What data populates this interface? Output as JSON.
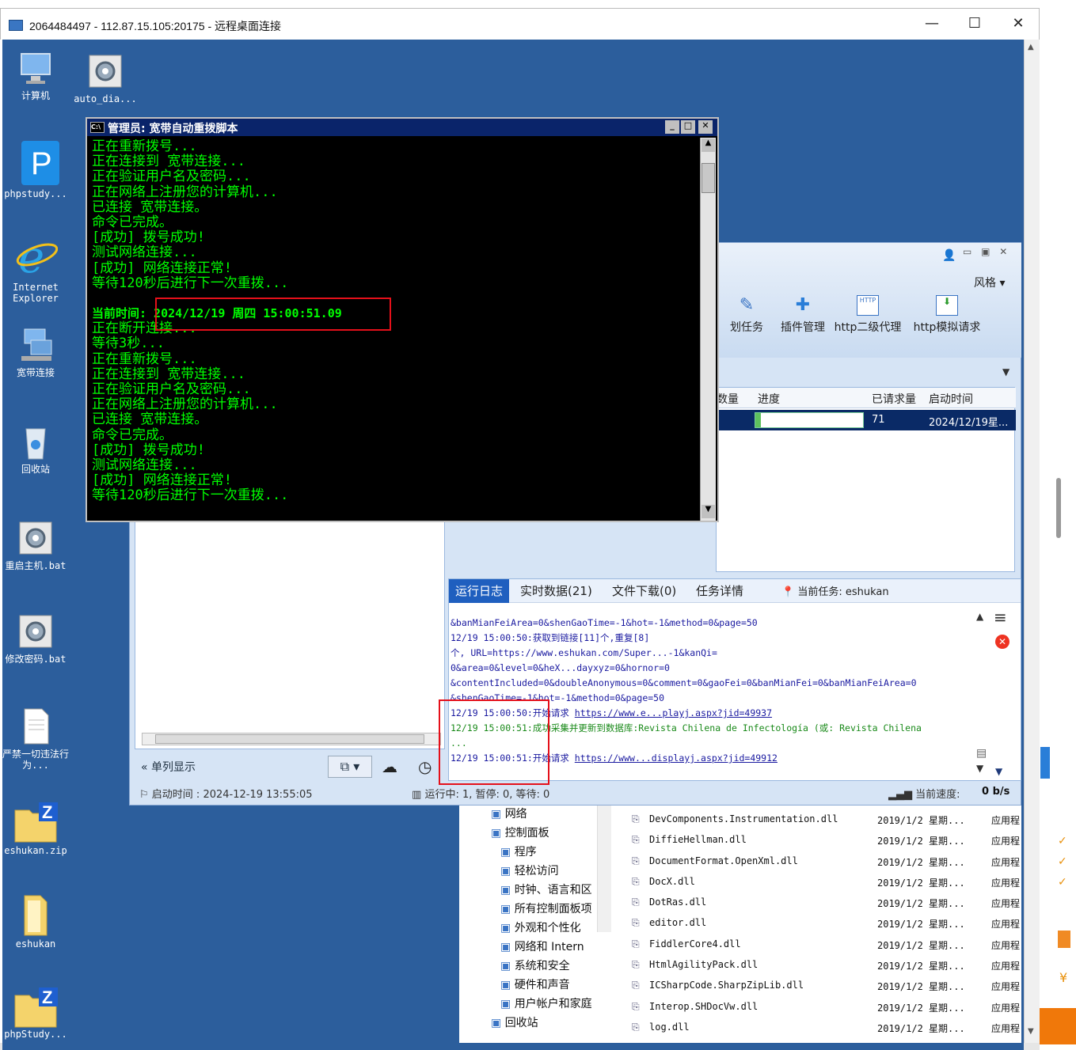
{
  "rdp": {
    "title": "2064484497 - 112.87.15.105:20175 - 远程桌面连接",
    "minimize": "—",
    "maximize": "☐",
    "close": "✕"
  },
  "desktop_icons": [
    {
      "label": "计算机",
      "icon": "computer-icon"
    },
    {
      "label": "auto_dia...",
      "icon": "gear-file-icon"
    },
    {
      "label": "phpstudy...",
      "icon": "phpstudy-icon"
    },
    {
      "label": "Internet Explorer",
      "icon": "ie-icon"
    },
    {
      "label": "宽带连接",
      "icon": "network-icon"
    },
    {
      "label": "回收站",
      "icon": "recycle-bin-icon"
    },
    {
      "label": "重启主机.bat",
      "icon": "gear-file-icon"
    },
    {
      "label": "修改密码.bat",
      "icon": "gear-file-icon"
    },
    {
      "label": "严禁一切违法行为...",
      "icon": "text-file-icon"
    },
    {
      "label": "eshukan.zip",
      "icon": "zip-folder-icon"
    },
    {
      "label": "eshukan",
      "icon": "folder-icon"
    },
    {
      "label": "phpStudy...",
      "icon": "zip-folder-icon"
    }
  ],
  "cmd": {
    "title": "管理员:  宽带自动重拨脚本",
    "lines": [
      "正在重新拨号...",
      "正在连接到 宽带连接...",
      "正在验证用户名及密码...",
      "正在网络上注册您的计算机...",
      "已连接 宽带连接。",
      "命令已完成。",
      "[成功] 拨号成功!",
      "测试网络连接...",
      "[成功] 网络连接正常!",
      "等待120秒后进行下一次重拨...",
      "",
      "当前时间: 2024/12/19 周四 15:00:51.09",
      "正在断开连接...",
      "等待3秒...",
      "正在重新拨号...",
      "正在连接到 宽带连接...",
      "正在验证用户名及密码...",
      "正在网络上注册您的计算机...",
      "已连接 宽带连接。",
      "命令已完成。",
      "[成功] 拨号成功!",
      "测试网络连接...",
      "[成功] 网络连接正常!",
      "等待120秒后进行下一次重拨..."
    ]
  },
  "app": {
    "style_label": "风格",
    "toolbar": [
      {
        "label": "划任务",
        "icon": "task-edit-icon"
      },
      {
        "label": "插件管理",
        "icon": "puzzle-icon"
      },
      {
        "label": "http二级代理",
        "icon": "http-icon"
      },
      {
        "label": "http模拟请求",
        "icon": "http-download-icon"
      }
    ],
    "table": {
      "headers": [
        "数量",
        "进度",
        "已请求量",
        "启动时间"
      ],
      "row": {
        "count": "",
        "progress": 0.05,
        "requested": "71",
        "start": "2024/12/19星..."
      }
    },
    "tabs": [
      {
        "label": "运行日志",
        "active": true
      },
      {
        "label": "实时数据(21)",
        "active": false
      },
      {
        "label": "文件下载(0)",
        "active": false
      },
      {
        "label": "任务详情",
        "active": false
      }
    ],
    "current_task": "当前任务: eshukan",
    "log_lines": [
      {
        "text": "&banMianFeiArea=0&shenGaoTime=-1&hot=-1&method=0&page=50",
        "color": "#1a1aa0"
      },
      {
        "text": "12/19 15:00:50:获取到链接[11]个,重复[8]",
        "color": "#1a1aa0"
      },
      {
        "text": "个, URL=https://www.eshukan.com/Super...-1&kanQi=",
        "color": "#1a1aa0"
      },
      {
        "text": "0&area=0&level=0&heX...dayxyz=0&hornor=0",
        "color": "#1a1aa0"
      },
      {
        "text": "&contentIncluded=0&doubleAnonymous=0&comment=0&gaoFei=0&banMianFei=0&banMianFeiArea=0",
        "color": "#1a1aa0"
      },
      {
        "text": "&shenGaoTime=-1&hot=-1&method=0&page=50",
        "color": "#1a1aa0"
      },
      {
        "text": "12/19 15:00:50:开始请求 ",
        "link": "https://www.e...playj.aspx?jid=49937",
        "color": "#1a1aa0"
      },
      {
        "text": "12/19 15:00:51:成功采集并更新到数据库:Revista Chilena de Infectología (或: Revista Chilena",
        "color": "#1a8a1a"
      },
      {
        "text": "...",
        "color": "#1a8a1a"
      },
      {
        "text": "12/19 15:00:51:开始请求 ",
        "link": "https://www...displayj.aspx?jid=49912",
        "color": "#1a1aa0"
      }
    ],
    "left_panel": {
      "single_column_label": "单列显示",
      "start_time": "启动时间 : 2024-12-19 13:55:05"
    },
    "status": {
      "running": "运行中: 1, 暂停: 0, 等待: 0",
      "speed_label": "当前速度:",
      "speed_value": "0 b/s"
    }
  },
  "explorer": {
    "tree": [
      {
        "label": "网络",
        "indent": 0
      },
      {
        "label": "控制面板",
        "indent": 0
      },
      {
        "label": "程序",
        "indent": 1
      },
      {
        "label": "轻松访问",
        "indent": 1
      },
      {
        "label": "时钟、语言和区",
        "indent": 1
      },
      {
        "label": "所有控制面板项",
        "indent": 1
      },
      {
        "label": "外观和个性化",
        "indent": 1
      },
      {
        "label": "网络和 Intern",
        "indent": 1
      },
      {
        "label": "系统和安全",
        "indent": 1
      },
      {
        "label": "硬件和声音",
        "indent": 1
      },
      {
        "label": "用户帐户和家庭",
        "indent": 1
      },
      {
        "label": "回收站",
        "indent": 0
      }
    ],
    "files": [
      {
        "name": "DevComponents.Instrumentation.dll",
        "date": "2019/1/2 星期...",
        "type": "应用程"
      },
      {
        "name": "DiffieHellman.dll",
        "date": "2019/1/2 星期...",
        "type": "应用程"
      },
      {
        "name": "DocumentFormat.OpenXml.dll",
        "date": "2019/1/2 星期...",
        "type": "应用程"
      },
      {
        "name": "DocX.dll",
        "date": "2019/1/2 星期...",
        "type": "应用程"
      },
      {
        "name": "DotRas.dll",
        "date": "2019/1/2 星期...",
        "type": "应用程"
      },
      {
        "name": "editor.dll",
        "date": "2019/1/2 星期...",
        "type": "应用程"
      },
      {
        "name": "FiddlerCore4.dll",
        "date": "2019/1/2 星期...",
        "type": "应用程"
      },
      {
        "name": "HtmlAgilityPack.dll",
        "date": "2019/1/2 星期...",
        "type": "应用程"
      },
      {
        "name": "ICSharpCode.SharpZipLib.dll",
        "date": "2019/1/2 星期...",
        "type": "应用程"
      },
      {
        "name": "Interop.SHDocVw.dll",
        "date": "2019/1/2 星期...",
        "type": "应用程"
      },
      {
        "name": "log.dll",
        "date": "2019/1/2 星期...",
        "type": "应用程"
      }
    ]
  },
  "right_edge": {
    "yen": "¥"
  },
  "colors": {
    "desktop": "#2c5e9c",
    "cmd_text": "#00ff00",
    "highlight": "#e5101a",
    "tab_active": "#1f5fbf"
  }
}
